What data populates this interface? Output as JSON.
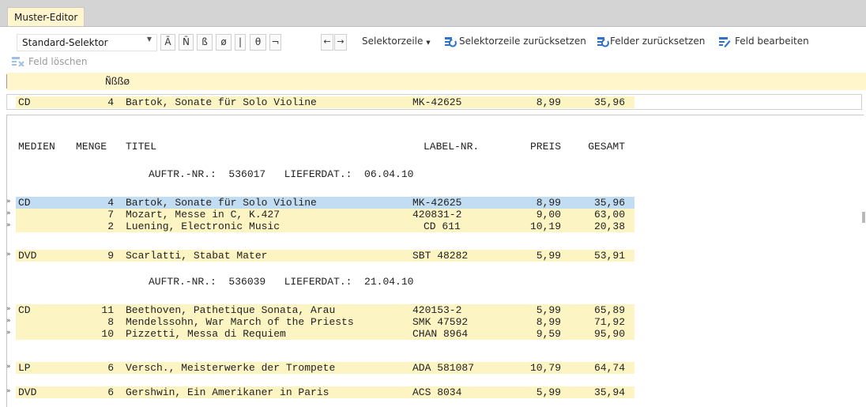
{
  "window": {
    "tab_title": "Muster-Editor"
  },
  "toolbar": {
    "selector_value": "Standard-Selektor",
    "chars": [
      "Ã",
      "Ñ",
      "ß",
      "ø",
      "|",
      "θ",
      "¬"
    ],
    "arrow_left": "←",
    "arrow_right": "→",
    "selector_row_label": "Selektorzeile",
    "reset_selector_row": "Selektorzeile zurücksetzen",
    "reset_fields": "Felder zurücksetzen",
    "edit_field": "Feld bearbeiten",
    "delete_field": "Feld löschen"
  },
  "editor": {
    "selector_chars": "Ñßßø",
    "sample_row": {
      "medium": "CD",
      "qty": "4",
      "title": "Bartok, Sonate für Solo Violine",
      "label": "MK-42625",
      "price": "8,99",
      "total": "35,96"
    },
    "header": {
      "medien": "MEDIEN",
      "menge": "MENGE",
      "titel": "TITEL",
      "label": "LABEL-NR.",
      "preis": "PREIS",
      "gesamt": "GESAMT"
    },
    "orders": [
      {
        "line": "AUFTR.-NR.:  536017   LIEFERDAT.:  06.04.10"
      },
      {
        "line": "AUFTR.-NR.:  536039   LIEFERDAT.:  21.04.10"
      }
    ],
    "rows": [
      {
        "marker": "»",
        "medium": "CD",
        "qty": "4",
        "title": "Bartok, Sonate für Solo Violine",
        "label": "MK-42625",
        "price": "8,99",
        "total": "35,96"
      },
      {
        "marker": "»",
        "medium": "",
        "qty": "7",
        "title": "Mozart, Messe in C, K.427",
        "label": "420831-2",
        "price": "9,00",
        "total": "63,00"
      },
      {
        "marker": "»",
        "medium": "",
        "qty": "2",
        "title": "Luening, Electronic Music",
        "label": "CD 611",
        "price": "10,19",
        "total": "20,38"
      },
      {
        "marker": "»",
        "medium": "DVD",
        "qty": "9",
        "title": "Scarlatti, Stabat Mater",
        "label": "SBT 48282",
        "price": "5,99",
        "total": "53,91"
      },
      {
        "marker": "»",
        "medium": "CD",
        "qty": "11",
        "title": "Beethoven, Pathetique Sonata, Arau",
        "label": "420153-2",
        "price": "5,99",
        "total": "65,89"
      },
      {
        "marker": "»",
        "medium": "",
        "qty": "8",
        "title": "Mendelssohn, War March of the Priests",
        "label": "SMK 47592",
        "price": "8,99",
        "total": "71,92"
      },
      {
        "marker": "»",
        "medium": "",
        "qty": "10",
        "title": "Pizzetti, Messa di Requiem",
        "label": "CHAN 8964",
        "price": "9,59",
        "total": "95,90"
      },
      {
        "marker": "»",
        "medium": "LP",
        "qty": "6",
        "title": "Versch., Meisterwerke der Trompete",
        "label": "ADA 581087",
        "price": "10,79",
        "total": "64,74"
      },
      {
        "marker": "»",
        "medium": "DVD",
        "qty": "6",
        "title": "Gershwin, Ein Amerikaner in Paris",
        "label": "ACS 8034",
        "price": "5,99",
        "total": "35,94"
      }
    ]
  }
}
